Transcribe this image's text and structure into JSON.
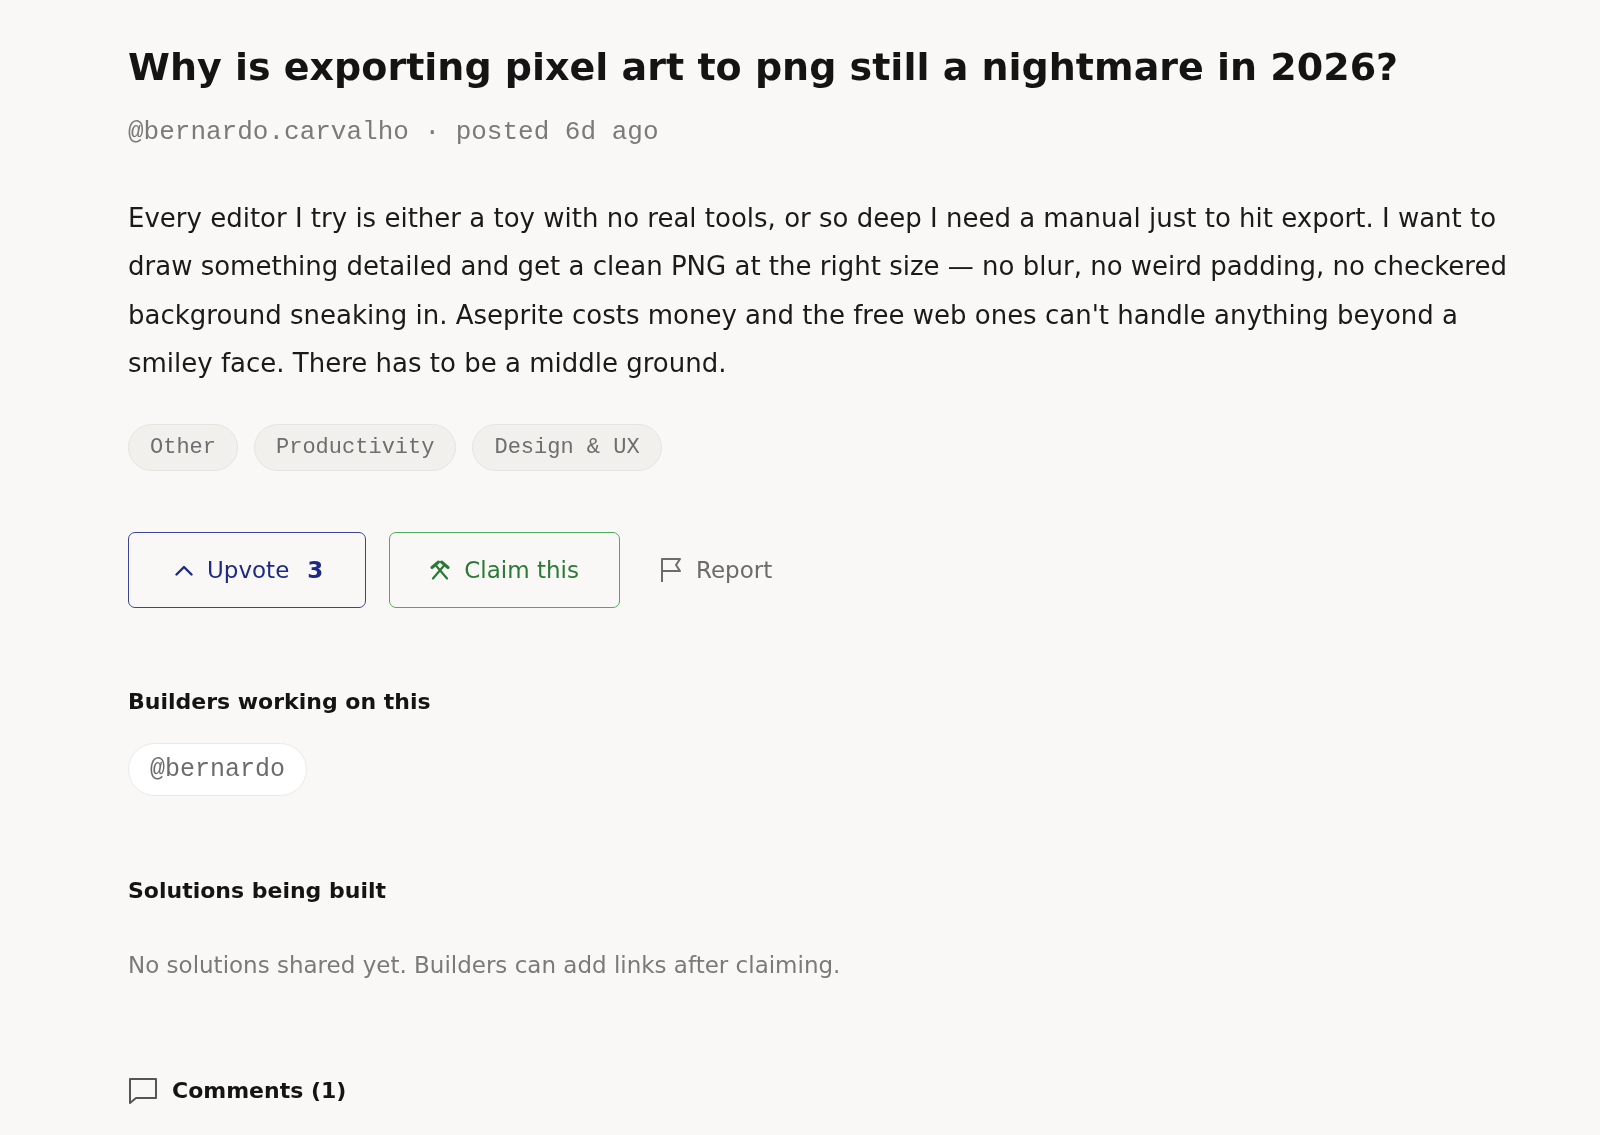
{
  "post": {
    "title": "Why is exporting pixel art to png still a nightmare in 2026?",
    "meta": "@bernardo.carvalho · posted 6d ago",
    "body": "Every editor I try is either a toy with no real tools, or so deep I need a manual just to hit export. I want to draw something detailed and get a clean PNG at the right size — no blur, no weird padding, no checkered background sneaking in. Aseprite costs money and the free web ones can't handle anything beyond a smiley face. There has to be a middle ground."
  },
  "tags": [
    "Other",
    "Productivity",
    "Design & UX"
  ],
  "actions": [
    {
      "kind": "upvote",
      "label": "Upvote",
      "count": "3"
    },
    {
      "kind": "claim",
      "label": "Claim this"
    },
    {
      "kind": "report",
      "label": "Report"
    }
  ],
  "builders": {
    "heading": "Builders working on this",
    "items": [
      "@bernardo"
    ]
  },
  "solutions": {
    "heading": "Solutions being built",
    "empty_text": "No solutions shared yet. Builders can add links after claiming."
  },
  "comments": {
    "label": "Comments (1)"
  }
}
